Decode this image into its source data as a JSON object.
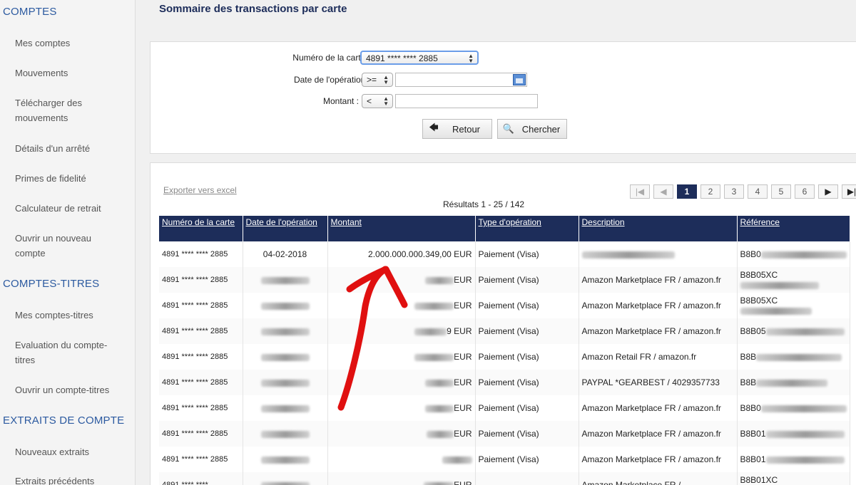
{
  "sidebar": {
    "sections": [
      {
        "heading": "COMPTES",
        "items": [
          "Mes comptes",
          "Mouvements",
          "Télécharger des mouvements",
          "Détails d'un arrêté",
          "Primes de fidelité",
          "Calculateur de retrait",
          "Ouvrir un nouveau compte"
        ]
      },
      {
        "heading": "COMPTES-TITRES",
        "items": [
          "Mes comptes-titres",
          "Evaluation du compte-titres",
          "Ouvrir un compte-titres"
        ]
      },
      {
        "heading": "EXTRAITS DE COMPTE",
        "items": [
          "Nouveaux extraits",
          "Extraits précédents"
        ]
      }
    ]
  },
  "main": {
    "title": "Sommaire des transactions par carte"
  },
  "search_form": {
    "card_label": "Numéro de la carte :",
    "card_value": "4891 **** **** 2885",
    "date_label": "Date de l'opération :",
    "date_operator": ">=",
    "date_value": "",
    "amount_label": "Montant :",
    "amount_operator": "<",
    "amount_value": "",
    "back_button": "Retour",
    "search_button": "Chercher"
  },
  "results": {
    "export_link": "Exporter vers excel",
    "count": "Résultats 1 - 25 / 142",
    "pagination": {
      "current": "1",
      "pages": [
        "1",
        "2",
        "3",
        "4",
        "5",
        "6"
      ]
    },
    "columns": [
      "Numéro de la carte",
      "Date de l'opération",
      "Montant",
      "Type d'opération",
      "Description",
      "Référence"
    ],
    "rows": [
      {
        "card": "4891 **** **** 2885",
        "date": "04-02-2018",
        "amount": "2.000.000.000.349,00 EUR",
        "type": "Paiement (Visa)",
        "description": "",
        "reference": "B8B0"
      },
      {
        "card": "4891 **** **** 2885",
        "date": "",
        "amount": "EUR",
        "type": "Paiement (Visa)",
        "description": "Amazon Marketplace FR / amazon.fr",
        "reference": "B8B05XC"
      },
      {
        "card": "4891 **** **** 2885",
        "date": "",
        "amount": "EUR",
        "type": "Paiement (Visa)",
        "description": "Amazon Marketplace FR / amazon.fr",
        "reference": "B8B05XC"
      },
      {
        "card": "4891 **** **** 2885",
        "date": "",
        "amount": "9 EUR",
        "type": "Paiement (Visa)",
        "description": "Amazon Marketplace FR / amazon.fr",
        "reference": "B8B05"
      },
      {
        "card": "4891 **** **** 2885",
        "date": "",
        "amount": "EUR",
        "type": "Paiement (Visa)",
        "description": "Amazon Retail FR / amazon.fr",
        "reference": "B8B"
      },
      {
        "card": "4891 **** **** 2885",
        "date": "",
        "amount": "EUR",
        "type": "Paiement (Visa)",
        "description": "PAYPAL *GEARBEST / 4029357733",
        "reference": "B8B"
      },
      {
        "card": "4891 **** **** 2885",
        "date": "",
        "amount": "EUR",
        "type": "Paiement (Visa)",
        "description": "Amazon Marketplace FR / amazon.fr",
        "reference": "B8B0"
      },
      {
        "card": "4891 **** **** 2885",
        "date": "",
        "amount": "EUR",
        "type": "Paiement (Visa)",
        "description": "Amazon Marketplace FR / amazon.fr",
        "reference": "B8B01"
      },
      {
        "card": "4891 **** **** 2885",
        "date": "",
        "amount": "",
        "type": "Paiement (Visa)",
        "description": "Amazon Marketplace FR / amazon.fr",
        "reference": "B8B01"
      },
      {
        "card": "4891 **** ****",
        "date": "",
        "amount": "EUR",
        "type": "",
        "description": "Amazon Marketplace FR /",
        "reference": "B8B01XC"
      }
    ]
  },
  "colors": {
    "header_navy": "#1d2d5a",
    "sidebar_heading_blue": "#2c5aa0",
    "annotation_arrow": "#e01010"
  }
}
